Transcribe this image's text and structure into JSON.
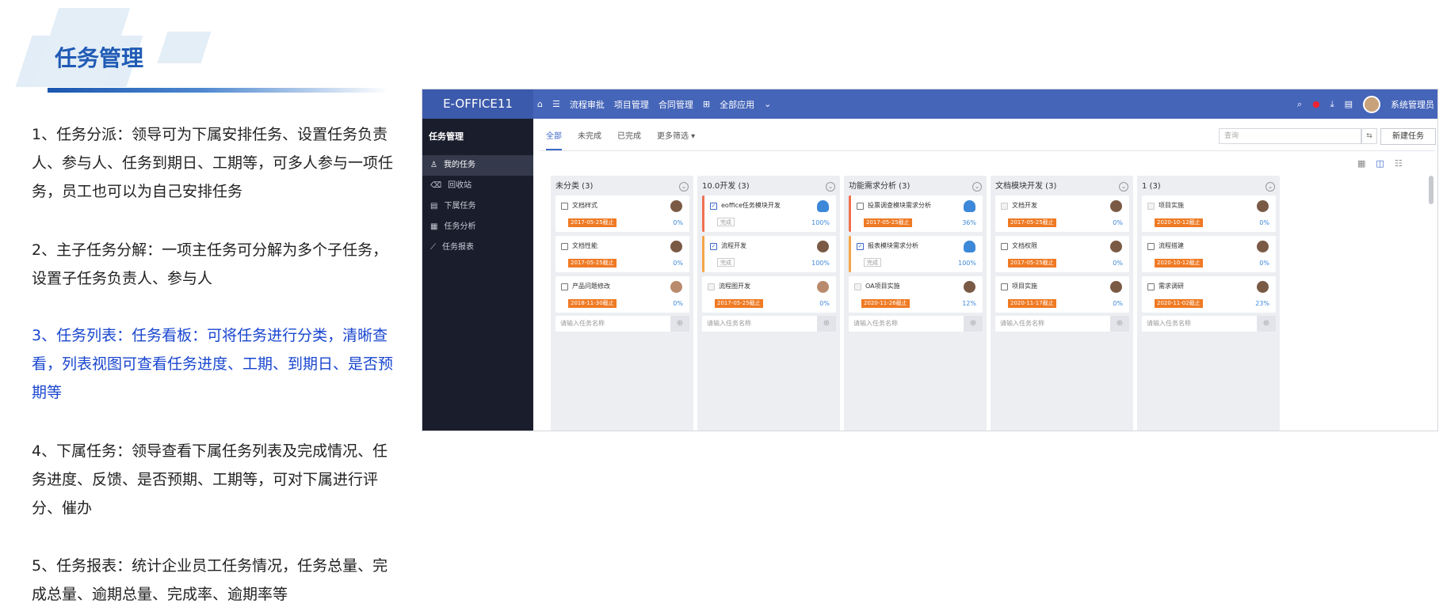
{
  "page": {
    "title": "任务管理",
    "paragraphs": [
      "1、任务分派：领导可为下属安排任务、设置任务负责人、参与人、任务到期日、工期等，可多人参与一项任务，员工也可以为自己安排任务",
      "2、主子任务分解：一项主任务可分解为多个子任务，设置子任务负责人、参与人",
      "3、任务列表：任务看板：可将任务进行分类，清晰查看，列表视图可查看任务进度、工期、到期日、是否预期等",
      "4、下属任务：领导查看下属任务列表及完成情况、任务进度、反馈、是否预期、工期等，可对下属进行评分、催办",
      "5、任务报表：统计企业员工任务情况，任务总量、完成总量、逾期总量、完成率、逾期率等"
    ],
    "accent": "#1f5bb5",
    "highlight": "#1946cf"
  },
  "app": {
    "brand": "E-OFFICE11",
    "nav": [
      "流程审批",
      "项目管理",
      "合同管理",
      "全部应用"
    ],
    "user": "系统管理员",
    "topbar_color": "#4565b9",
    "sidebar": {
      "title": "任务管理",
      "items": [
        {
          "label": "我的任务",
          "icon": "person-icon"
        },
        {
          "label": "回收站",
          "icon": "trash-icon"
        },
        {
          "label": "下属任务",
          "icon": "doc-icon"
        },
        {
          "label": "任务分析",
          "icon": "analysis-icon"
        },
        {
          "label": "任务报表",
          "icon": "chart-icon"
        }
      ]
    },
    "tabs": [
      "全部",
      "未完成",
      "已完成",
      "更多筛选"
    ],
    "search_placeholder": "查询",
    "new_task": "新建任务",
    "add_placeholder": "请输入任务名称",
    "columns": [
      {
        "title": "未分类 (3)",
        "cards": [
          {
            "title": "文档样式",
            "due": "2017-05-25截止",
            "pct": "0%",
            "state": "open",
            "avatar": "man"
          },
          {
            "title": "文档性能",
            "due": "2017-05-25截止",
            "pct": "0%",
            "state": "open",
            "avatar": "man"
          },
          {
            "title": "产品问题修改",
            "due": "2018-11-30截止",
            "pct": "0%",
            "state": "open",
            "avatar": "girl"
          }
        ]
      },
      {
        "title": "10.0开发 (3)",
        "cards": [
          {
            "title": "eoffice任务模块开发",
            "due": "完成",
            "pct": "100%",
            "state": "done",
            "avatar": "blue",
            "flag": "red"
          },
          {
            "title": "流程开发",
            "due": "完成",
            "pct": "100%",
            "state": "done",
            "avatar": "man",
            "flag": "ora"
          },
          {
            "title": "流程图开发",
            "due": "2017-05-25截止",
            "pct": "0%",
            "state": "dis",
            "avatar": "girl"
          }
        ]
      },
      {
        "title": "功能需求分析 (3)",
        "cards": [
          {
            "title": "投票调查模块需求分析",
            "due": "2017-05-25截止",
            "pct": "36%",
            "state": "open",
            "avatar": "blue",
            "flag": "red"
          },
          {
            "title": "报表模块需求分析",
            "due": "完成",
            "pct": "100%",
            "state": "done",
            "avatar": "blue",
            "flag": "ora"
          },
          {
            "title": "OA项目实施",
            "due": "2020-11-26截止",
            "pct": "12%",
            "state": "dis",
            "avatar": "man"
          }
        ]
      },
      {
        "title": "文档模块开发 (3)",
        "cards": [
          {
            "title": "文档开发",
            "due": "2017-05-25截止",
            "pct": "0%",
            "state": "dis",
            "avatar": "man"
          },
          {
            "title": "文档权限",
            "due": "2017-05-25截止",
            "pct": "0%",
            "state": "open",
            "avatar": "man"
          },
          {
            "title": "项目实施",
            "due": "2020-11-17截止",
            "pct": "0%",
            "state": "open",
            "avatar": "man"
          }
        ]
      },
      {
        "title": "1 (3)",
        "cards": [
          {
            "title": "项目实施",
            "due": "2020-10-12截止",
            "pct": "0%",
            "state": "dis",
            "avatar": "man"
          },
          {
            "title": "流程搭建",
            "due": "2020-10-12截止",
            "pct": "0%",
            "state": "open",
            "avatar": "man"
          },
          {
            "title": "需求调研",
            "due": "2020-11-02截止",
            "pct": "23%",
            "state": "open",
            "avatar": "man"
          }
        ]
      }
    ]
  }
}
